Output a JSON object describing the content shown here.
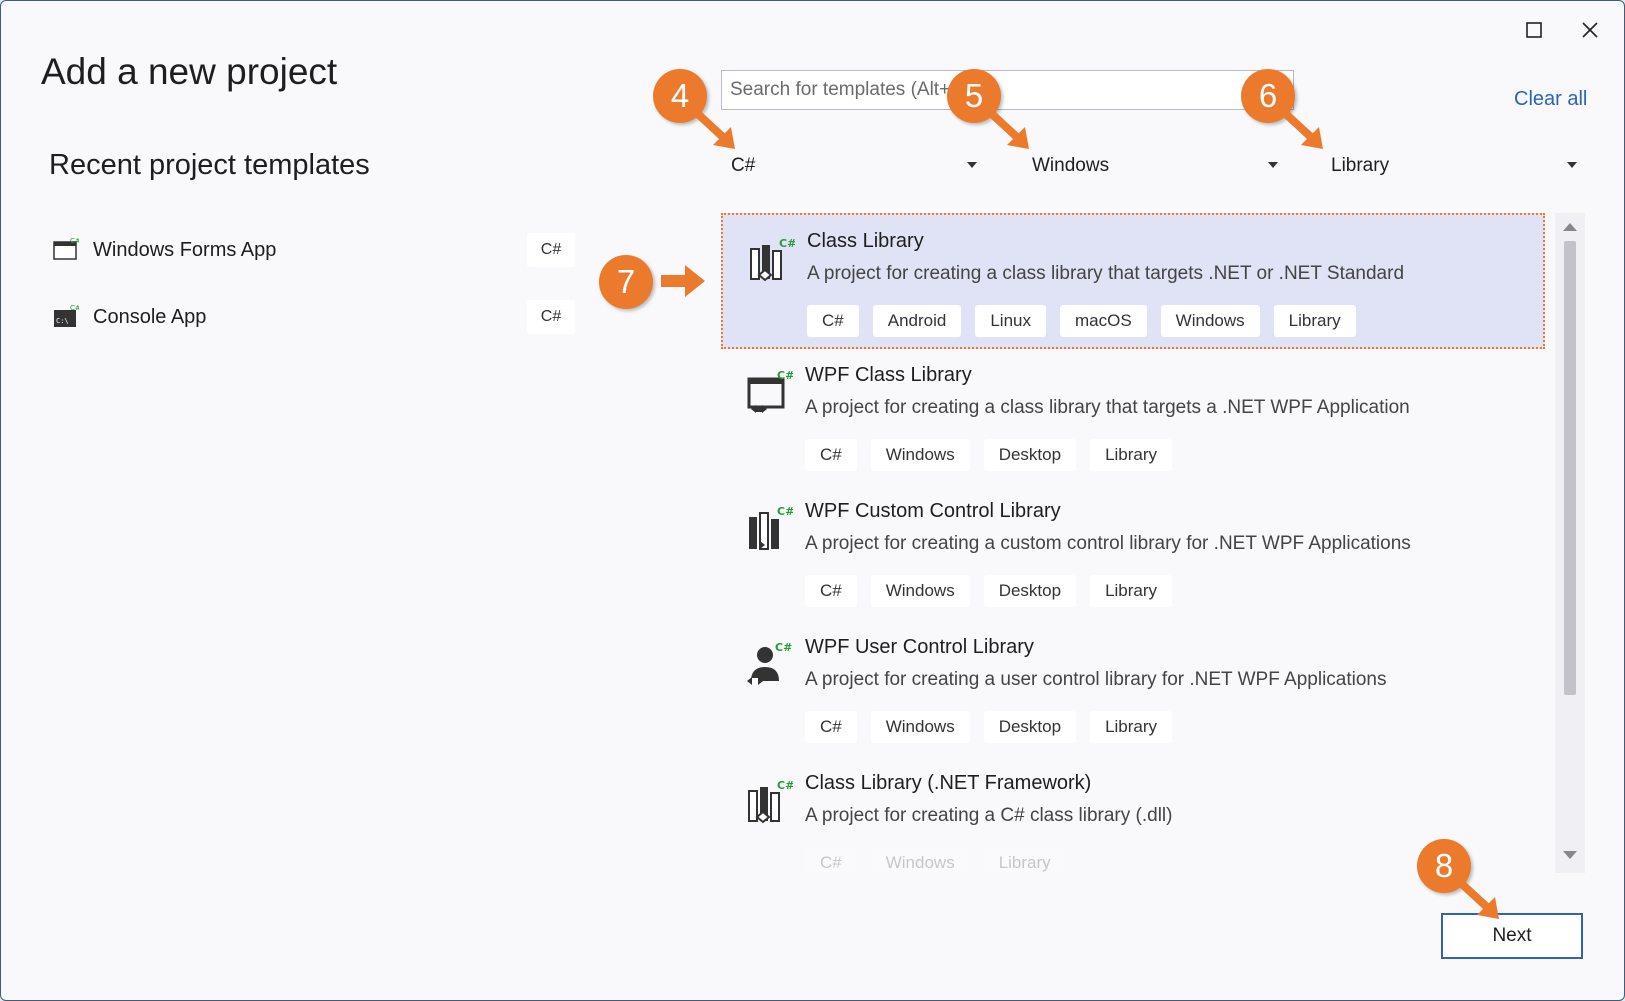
{
  "window": {
    "maximize_icon": "maximize-icon",
    "close_icon": "close-icon"
  },
  "page_title": "Add a new project",
  "recent": {
    "title": "Recent project templates",
    "items": [
      {
        "label": "Windows Forms App",
        "lang": "C#",
        "icon": "windows-forms-icon"
      },
      {
        "label": "Console App",
        "lang": "C#",
        "icon": "console-icon"
      }
    ]
  },
  "search": {
    "placeholder": "Search for templates (Alt+S)",
    "value": ""
  },
  "clear_all": "Clear all",
  "filters": {
    "language": "C#",
    "platform": "Windows",
    "project_type": "Library"
  },
  "templates": [
    {
      "name": "Class Library",
      "description": "A project for creating a class library that targets .NET or .NET Standard",
      "tags": [
        "C#",
        "Android",
        "Linux",
        "macOS",
        "Windows",
        "Library"
      ],
      "selected": true
    },
    {
      "name": "WPF Class Library",
      "description": "A project for creating a class library that targets a .NET WPF Application",
      "tags": [
        "C#",
        "Windows",
        "Desktop",
        "Library"
      ]
    },
    {
      "name": "WPF Custom Control Library",
      "description": "A project for creating a custom control library for .NET WPF Applications",
      "tags": [
        "C#",
        "Windows",
        "Desktop",
        "Library"
      ]
    },
    {
      "name": "WPF User Control Library",
      "description": "A project for creating a user control library for .NET WPF Applications",
      "tags": [
        "C#",
        "Windows",
        "Desktop",
        "Library"
      ]
    },
    {
      "name": "Class Library (.NET Framework)",
      "description": "A project for creating a C# class library (.dll)",
      "tags": [
        "C#",
        "Windows",
        "Library"
      ]
    }
  ],
  "next_label": "Next",
  "steps": {
    "s4": "4",
    "s5": "5",
    "s6": "6",
    "s7": "7",
    "s8": "8"
  },
  "colors": {
    "accent_orange": "#ec7a2c",
    "link_blue": "#2b63b8",
    "selected_bg": "#dfe3f5",
    "button_border": "#2d63b8"
  }
}
